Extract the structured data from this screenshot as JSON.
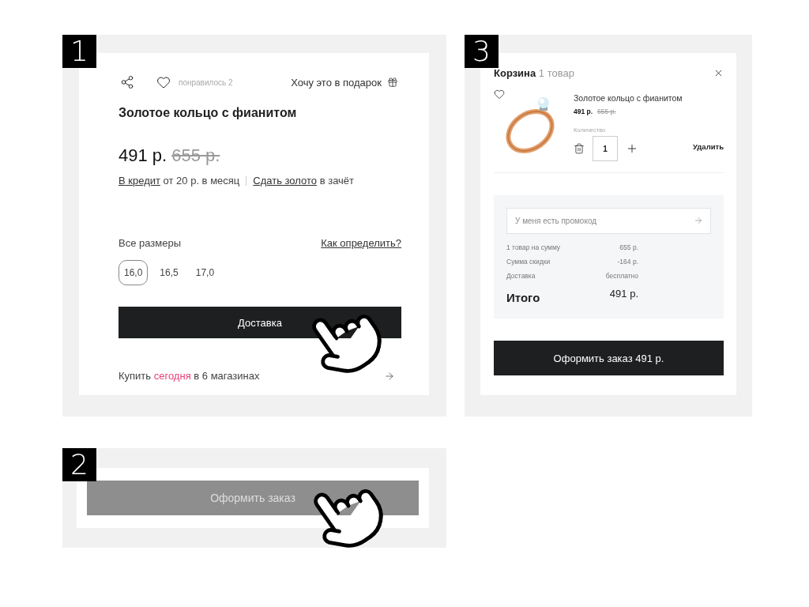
{
  "product_step": {
    "badge": "1",
    "likes": "понравилось 2",
    "gift": "Хочу это в подарок",
    "title": "Золотое кольцо с фианитом",
    "price": "491 р.",
    "old_price": "655 р.",
    "credit": {
      "link": "В кредит",
      "text": "от 20 р. в месяц"
    },
    "trade_in": {
      "link": "Сдать золото",
      "text": "в зачёт"
    },
    "sizes_label": "Все размеры",
    "sizes_help": "Как определить?",
    "sizes": [
      {
        "label": "16,0",
        "selected": true
      },
      {
        "label": "16,5",
        "selected": false
      },
      {
        "label": "17,0",
        "selected": false
      }
    ],
    "button": "Доставка",
    "stores": {
      "prefix": "Купить",
      "highlight": "сегодня",
      "suffix": "в 6 магазинах"
    }
  },
  "order_step": {
    "badge": "2",
    "button": "Оформить заказ",
    "disabled": true
  },
  "cart_step": {
    "badge": "3",
    "title": "Корзина",
    "count": "1 товар",
    "item": {
      "name": "Золотое кольцо с фианитом",
      "price": "491 р.",
      "old_price": "655 р.",
      "quantity_label": "Количество",
      "quantity": "1",
      "remove": "Удалить"
    },
    "promo_placeholder": "У меня есть промокод",
    "summary": [
      {
        "label": "1 товар на сумму",
        "value": "655 р."
      },
      {
        "label": "Сумма скидки",
        "value": "-164 р."
      },
      {
        "label": "Доставка",
        "value": "бесплатно"
      }
    ],
    "total": {
      "label": "Итого",
      "value": "491 р."
    },
    "checkout": "Оформить заказ 491 р."
  }
}
